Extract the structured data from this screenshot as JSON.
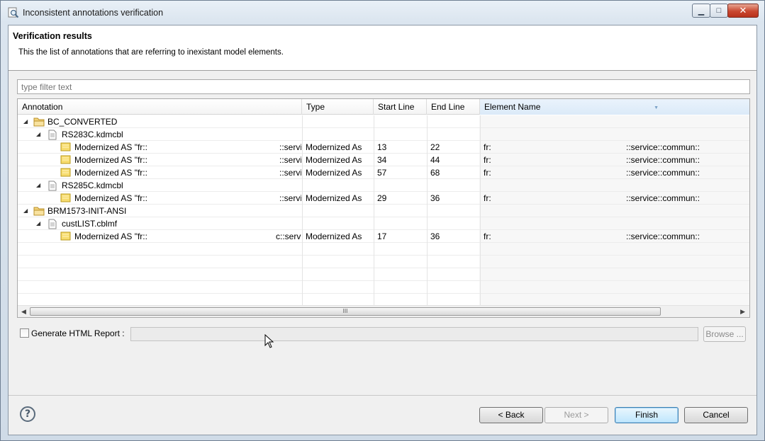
{
  "window": {
    "title": "Inconsistent annotations verification",
    "minimize": "▁",
    "maximize": "□",
    "close": "✕"
  },
  "header": {
    "title": "Verification results",
    "description": "This the list of annotations that are referring to inexistant model elements."
  },
  "filter": {
    "placeholder": "type filter text"
  },
  "table": {
    "columns": [
      "Annotation",
      "Type",
      "Start Line",
      "End Line",
      "Element Name"
    ],
    "rows": [
      {
        "level": 0,
        "kind": "folder",
        "expanded": true,
        "annotation": "BC_CONVERTED"
      },
      {
        "level": 1,
        "kind": "file",
        "expanded": true,
        "annotation": "RS283C.kdmcbl"
      },
      {
        "level": 2,
        "kind": "annot",
        "annotation": "Modernized AS \"fr::",
        "annotation_tail": "::servi",
        "type": "Modernized As",
        "start": "13",
        "end": "22",
        "element": "fr:",
        "element_tail": "::service::commun::"
      },
      {
        "level": 2,
        "kind": "annot",
        "annotation": "Modernized AS \"fr::",
        "annotation_tail": "::servi",
        "type": "Modernized As",
        "start": "34",
        "end": "44",
        "element": "fr:",
        "element_tail": "::service::commun::"
      },
      {
        "level": 2,
        "kind": "annot",
        "annotation": "Modernized AS \"fr::",
        "annotation_tail": "::servi",
        "type": "Modernized As",
        "start": "57",
        "end": "68",
        "element": "fr:",
        "element_tail": "::service::commun::"
      },
      {
        "level": 1,
        "kind": "file",
        "expanded": true,
        "annotation": "RS285C.kdmcbl"
      },
      {
        "level": 2,
        "kind": "annot",
        "annotation": "Modernized AS \"fr::",
        "annotation_tail": "::servi",
        "type": "Modernized As",
        "start": "29",
        "end": "36",
        "element": "fr:",
        "element_tail": "::service::commun::"
      },
      {
        "level": 0,
        "kind": "folder",
        "expanded": true,
        "annotation": "BRM1573-INIT-ANSI"
      },
      {
        "level": 1,
        "kind": "file",
        "expanded": true,
        "annotation": "custLIST.cblmf"
      },
      {
        "level": 2,
        "kind": "annot",
        "annotation": "Modernized AS \"fr::",
        "annotation_tail": "c::servi",
        "type": "Modernized As",
        "start": "17",
        "end": "36",
        "element": "fr:",
        "element_tail": "::service::commun::"
      }
    ],
    "scroll_grip": "III"
  },
  "report": {
    "checkbox_label": "Generate HTML Report :",
    "checked": false,
    "browse_label": "Browse ..."
  },
  "buttons": {
    "back": "< Back",
    "next": "Next >",
    "finish": "Finish",
    "cancel": "Cancel"
  },
  "help_glyph": "?",
  "icons": [
    "search-icon",
    "folder-icon",
    "file-icon",
    "annotation-icon",
    "help-icon"
  ]
}
